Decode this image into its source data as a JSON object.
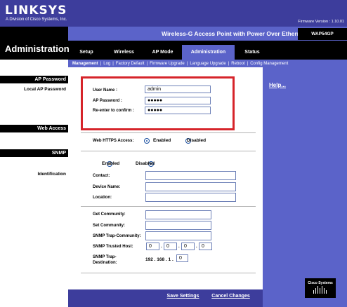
{
  "brand": {
    "name": "LINKSYS",
    "sub": "A Division of Cisco Systems, Inc.",
    "logo": "Cisco Systems"
  },
  "firmware": "Firmware Version : 1.10.01",
  "product": "Wireless-G Access Point with Power Over Ethernet",
  "model": "WAP54GP",
  "section": "Administration",
  "tabs": [
    "Setup",
    "Wireless",
    "AP Mode",
    "Administration",
    "Status"
  ],
  "subtabs": [
    "Management",
    "Log",
    "Factory Default",
    "Firmware Upgrade",
    "Language Upgrade",
    "Reboot",
    "Config Management"
  ],
  "left": {
    "ap_password_header": "AP Password",
    "local_ap_password": "Local AP Password",
    "web_access_header": "Web Access",
    "snmp_header": "SNMP",
    "identification": "Identification"
  },
  "help": "Help...",
  "credentials": {
    "username_label": "User Name :",
    "username_value": "admin",
    "ap_password_label": "AP Password :",
    "ap_password_value": "●●●●●",
    "reenter_label": "Re-enter to confirm :",
    "reenter_value": "●●●●●"
  },
  "web_https": {
    "label": "Web HTTPS Access:",
    "enabled": "Enabled",
    "disabled": "Disabled",
    "selected": "Enabled"
  },
  "snmp": {
    "enabled": "Enabled",
    "disabled": "Disabled",
    "selected": "Disabled",
    "contact": "Contact:",
    "device_name": "Device Name:",
    "location": "Location:",
    "get_community": "Get Community:",
    "set_community": "Set Community:",
    "trap_community": "SNMP Trap-Community:",
    "trusted_host": "SNMP Trusted Host:",
    "trusted_host_values": [
      "0",
      "0",
      "0",
      "0"
    ],
    "trap_destination": "SNMP Trap-Destination:",
    "trap_destination_prefix": "192 . 168 . 1 .",
    "trap_destination_last": "0",
    "dot": "."
  },
  "buttons": {
    "save": "Save Settings",
    "cancel": "Cancel Changes"
  },
  "colors": {
    "header_blue": "#3d3d9c",
    "nav_blue": "#5b63c9",
    "highlight_red": "#d6242a"
  }
}
